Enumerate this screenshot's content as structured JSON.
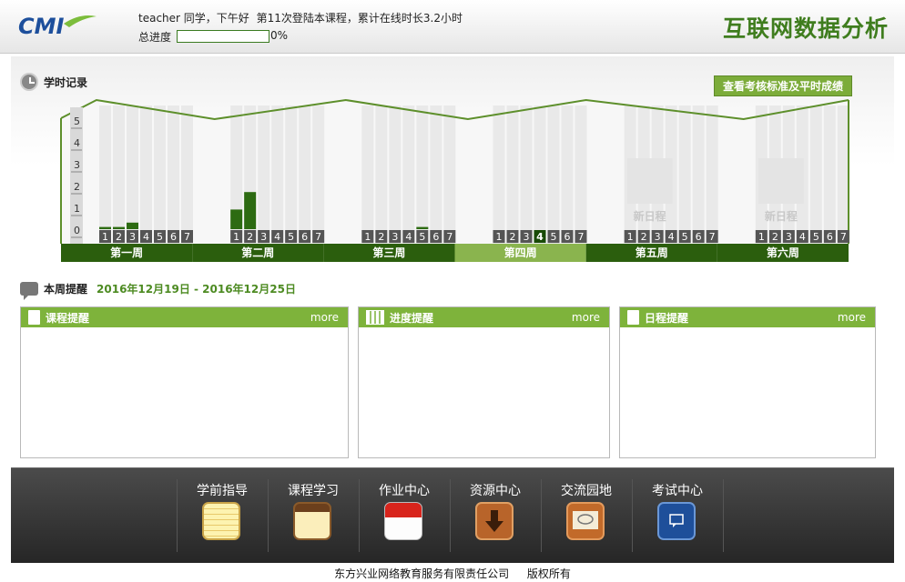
{
  "header": {
    "greeting_user": "teacher",
    "greeting_text": "同学，下午好",
    "login_info": "第11次登陆本课程，累计在线时长3.2小时",
    "progress_label": "总进度",
    "progress_value": "0%",
    "progress_fraction": 0,
    "app_title": "互联网数据分析"
  },
  "study_record": {
    "title": "学时记录",
    "assess_button": "查看考核标准及平时成绩",
    "new_schedule": "新日程",
    "chart_data": {
      "type": "bar",
      "ylim": [
        0,
        5
      ],
      "yticks": [
        "5",
        "4",
        "3",
        "2",
        "1",
        "0"
      ],
      "day_labels": [
        "1",
        "2",
        "3",
        "4",
        "5",
        "6",
        "7"
      ],
      "weeks": [
        {
          "label": "第一周",
          "values": [
            0.1,
            0.1,
            0.3,
            0,
            0,
            0,
            0
          ],
          "active": false,
          "empty": false
        },
        {
          "label": "第二周",
          "values": [
            0.9,
            1.7,
            0,
            0,
            0,
            0,
            0
          ],
          "active": false,
          "empty": false
        },
        {
          "label": "第三周",
          "values": [
            0,
            0,
            0,
            0,
            0.1,
            0,
            0
          ],
          "active": false,
          "empty": false
        },
        {
          "label": "第四周",
          "values": [
            0,
            0,
            0,
            0,
            0,
            0,
            0
          ],
          "active": true,
          "empty": false,
          "current_day": "4"
        },
        {
          "label": "第五周",
          "values": [
            0,
            0,
            0,
            0,
            0,
            0,
            0
          ],
          "active": false,
          "empty": true
        },
        {
          "label": "第六周",
          "values": [
            0,
            0,
            0,
            0,
            0,
            0,
            0
          ],
          "active": false,
          "empty": true
        }
      ]
    }
  },
  "reminders": {
    "title": "本周提醒",
    "date_range": "2016年12月19日 - 2016年12月25日",
    "boxes": [
      {
        "title": "课程提醒",
        "more": "more"
      },
      {
        "title": "进度提醒",
        "more": "more"
      },
      {
        "title": "日程提醒",
        "more": "more"
      }
    ]
  },
  "nav": {
    "items": [
      "学前指导",
      "课程学习",
      "作业中心",
      "资源中心",
      "交流园地",
      "考试中心"
    ]
  },
  "footer": {
    "company": "东方兴业网络教育服务有限责任公司",
    "rights": "版权所有"
  },
  "colors": {
    "brand_green": "#3f7d1e",
    "bar_green": "#2d6b12",
    "week_bar": "#2b5e0d",
    "week_active": "#8ab44e",
    "button_green": "#7cac3a"
  }
}
